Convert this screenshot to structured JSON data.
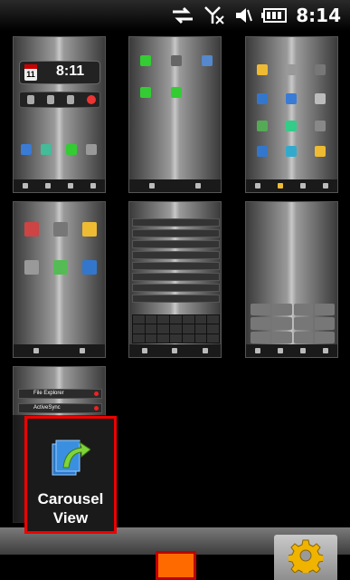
{
  "status_bar": {
    "time": "8:14",
    "icons": [
      "sync-arrows-icon",
      "no-signal-icon",
      "volume-mute-icon",
      "battery-icon"
    ]
  },
  "thumbnails": [
    {
      "name": "today-screen",
      "clock_time": "8:11",
      "date_day": "11"
    },
    {
      "name": "app-launcher-1"
    },
    {
      "name": "app-grid-1"
    },
    {
      "name": "start-menu-apps"
    },
    {
      "name": "calendar-agenda"
    },
    {
      "name": "phone-dialer"
    },
    {
      "name": "task-list",
      "items": [
        "File Explorer",
        "ActiveSync"
      ]
    }
  ],
  "dock": {
    "carousel": {
      "line1": "Carousel",
      "line2": "View"
    },
    "settings_icon": "gear-icon"
  },
  "colors": {
    "highlight": "#e00000",
    "orange_marker": "#ff6a00",
    "gear": "#f0b400"
  }
}
